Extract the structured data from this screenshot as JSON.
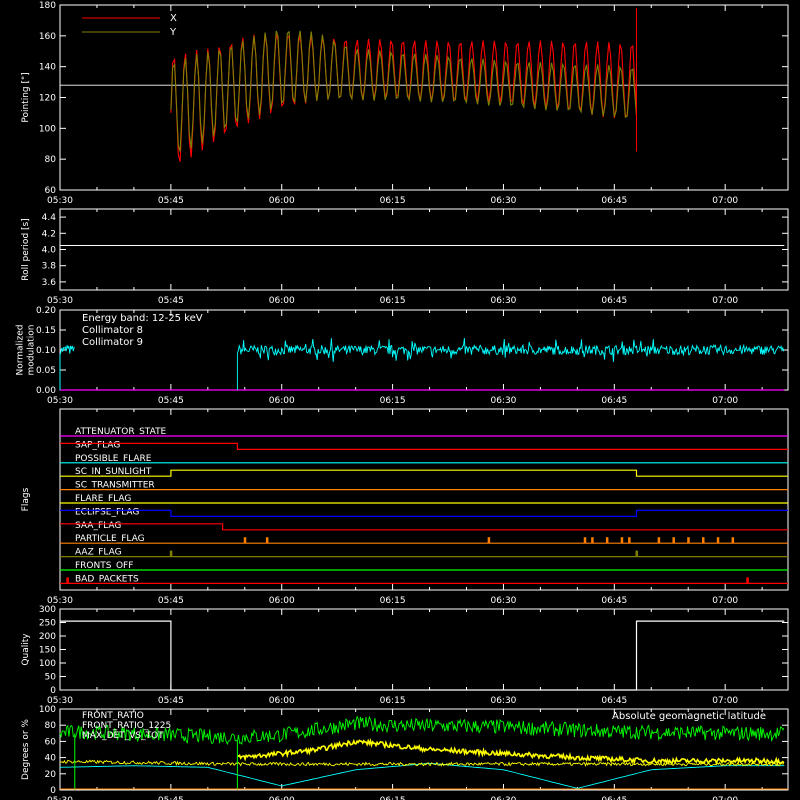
{
  "time_ticks": [
    "05:30",
    "05:45",
    "06:00",
    "06:15",
    "06:30",
    "06:45",
    "07:00"
  ],
  "colors": {
    "x": "#ff0000",
    "y": "#808000",
    "white": "#ffffff",
    "cyan": "#00ffff",
    "magenta": "#ff00ff",
    "red": "#ff0000",
    "orange": "#ff8000",
    "yellow": "#ffff00",
    "blue": "#0000ff",
    "olive": "#808000",
    "green": "#00ff00"
  },
  "chart_data": [
    {
      "type": "line",
      "panel": "pointing",
      "ylabel": "Pointing [\"]",
      "ylim": [
        60,
        180
      ],
      "yticks": [
        60,
        80,
        100,
        120,
        140,
        160,
        180
      ],
      "xlim": [
        "05:30",
        "07:08"
      ],
      "legend": [
        {
          "name": "X"
        },
        {
          "name": "Y"
        }
      ],
      "baseline": 128,
      "data_span": [
        "05:45",
        "06:48"
      ],
      "series": [
        {
          "name": "X",
          "x": [
            "05:45",
            "05:50",
            "05:55",
            "06:00",
            "06:05",
            "06:10",
            "06:15",
            "06:20",
            "06:25",
            "06:30",
            "06:35",
            "06:40",
            "06:45",
            "06:48"
          ],
          "upper": [
            148,
            152,
            160,
            163,
            160,
            158,
            158,
            157,
            157,
            157,
            157,
            157,
            156,
            156
          ],
          "lower": [
            72,
            88,
            102,
            112,
            118,
            118,
            119,
            117,
            117,
            116,
            113,
            110,
            106,
            104
          ]
        },
        {
          "name": "Y",
          "x": [
            "05:45",
            "05:50",
            "05:55",
            "06:00",
            "06:05",
            "06:10",
            "06:15",
            "06:20",
            "06:25",
            "06:30",
            "06:35",
            "06:40",
            "06:45",
            "06:48"
          ],
          "upper": [
            144,
            150,
            158,
            166,
            162,
            152,
            150,
            148,
            146,
            144,
            143,
            142,
            141,
            140
          ],
          "lower": [
            80,
            92,
            105,
            114,
            118,
            118,
            118,
            117,
            116,
            114,
            112,
            110,
            107,
            104
          ]
        }
      ]
    },
    {
      "type": "line",
      "panel": "roll",
      "ylabel": "Roll period [s]",
      "ylim": [
        3.5,
        4.5
      ],
      "yticks": [
        3.6,
        3.8,
        4.0,
        4.2,
        4.4
      ],
      "series": [
        {
          "x": [
            "05:30",
            "07:08"
          ],
          "y": [
            4.05,
            4.05
          ]
        }
      ]
    },
    {
      "type": "line",
      "panel": "modulation",
      "ylabel": [
        "Normalized",
        "modulation"
      ],
      "ylim": [
        0.0,
        0.2
      ],
      "yticks": [
        0.0,
        0.05,
        0.1,
        0.15,
        0.2
      ],
      "annotation": "Energy band: 12-25 keV",
      "series": [
        {
          "name": "Collimator 8",
          "segments": [
            [
              "05:30",
              "05:32"
            ],
            [
              "05:54",
              "07:08"
            ]
          ],
          "level": 0.1,
          "noise": 0.012
        },
        {
          "name": "Collimator 9",
          "segments": [
            [
              "05:30",
              "07:08"
            ]
          ],
          "level": 0.0
        }
      ]
    },
    {
      "type": "line",
      "panel": "flags",
      "ylabel": "Flags",
      "flags": [
        {
          "name": "ATTENUATOR_STATE",
          "color": "magenta",
          "steps": [
            [
              "05:30",
              0
            ]
          ]
        },
        {
          "name": "SAP_FLAG",
          "color": "red",
          "steps": [
            [
              "05:30",
              1
            ],
            [
              "05:54",
              0
            ]
          ]
        },
        {
          "name": "POSSIBLE_FLARE",
          "color": "cyan",
          "steps": [
            [
              "05:30",
              0
            ]
          ]
        },
        {
          "name": "SC_IN_SUNLIGHT",
          "color": "yellow",
          "steps": [
            [
              "05:30",
              0
            ],
            [
              "05:45",
              1
            ],
            [
              "06:48",
              0
            ]
          ]
        },
        {
          "name": "SC_TRANSMITTER",
          "color": "orange",
          "steps": [
            [
              "05:30",
              0
            ]
          ]
        },
        {
          "name": "FLARE_FLAG",
          "color": "yellow",
          "steps": [
            [
              "05:30",
              0
            ]
          ]
        },
        {
          "name": "ECLIPSE_FLAG",
          "color": "blue",
          "steps": [
            [
              "05:30",
              1
            ],
            [
              "05:45",
              0
            ],
            [
              "06:48",
              1
            ]
          ]
        },
        {
          "name": "SAA_FLAG",
          "color": "red",
          "steps": [
            [
              "05:30",
              1
            ],
            [
              "05:52",
              0
            ]
          ]
        },
        {
          "name": "PARTICLE_FLAG",
          "color": "orange",
          "spikes": [
            "05:55",
            "05:58",
            "06:28",
            "06:41",
            "06:42",
            "06:44",
            "06:46",
            "06:47",
            "06:51",
            "06:53",
            "06:55",
            "06:57",
            "06:59",
            "07:01"
          ]
        },
        {
          "name": "AAZ_FLAG",
          "color": "olive",
          "spikes": [
            "05:45",
            "06:48"
          ]
        },
        {
          "name": "FRONTS_OFF",
          "color": "green",
          "steps": [
            [
              "05:30",
              0
            ]
          ]
        },
        {
          "name": "BAD_PACKETS",
          "color": "red",
          "spikes": [
            "05:31",
            "07:03"
          ]
        }
      ]
    },
    {
      "type": "line",
      "panel": "quality",
      "ylabel": "Quality",
      "ylim": [
        0,
        300
      ],
      "yticks": [
        0,
        50,
        100,
        150,
        200,
        250,
        300
      ],
      "series": [
        {
          "x": [
            "05:30",
            "05:45",
            "05:45",
            "06:48",
            "06:48",
            "07:08"
          ],
          "y": [
            255,
            255,
            0,
            0,
            255,
            255
          ]
        }
      ]
    },
    {
      "type": "line",
      "panel": "ratios",
      "ylabel": "Degrees or %",
      "ylim": [
        0,
        100
      ],
      "yticks": [
        0,
        20,
        40,
        60,
        80,
        100
      ],
      "legend": [
        {
          "name": "FRONT_RATIO"
        },
        {
          "name": "FRONT_RATIO_1225"
        },
        {
          "name": "MAX_DET_VS_TOT"
        }
      ],
      "annotation": "Absolute geomagnetic latitude",
      "series": [
        {
          "name": "FRONT_RATIO",
          "x": [
            "05:54",
            "06:00",
            "06:05",
            "06:10",
            "06:15",
            "06:20",
            "06:30",
            "06:40",
            "06:50",
            "07:00",
            "07:08"
          ],
          "y": [
            40,
            45,
            50,
            60,
            55,
            50,
            45,
            40,
            36,
            36,
            36
          ]
        },
        {
          "name": "FRONT_RATIO_1225",
          "x": [
            "05:30",
            "05:32",
            "05:54",
            "06:00",
            "06:05",
            "06:10",
            "06:15",
            "06:30",
            "06:45",
            "07:00",
            "07:08"
          ],
          "y": [
            70,
            72,
            65,
            68,
            75,
            82,
            80,
            78,
            72,
            70,
            70
          ]
        },
        {
          "name": "MAX_DET_VS_TOT",
          "x": [
            "05:30",
            "05:32",
            "05:54",
            "07:08"
          ],
          "y": [
            35,
            35,
            32,
            32
          ]
        },
        {
          "name": "Absolute geomagnetic latitude",
          "x": [
            "05:30",
            "05:40",
            "05:50",
            "06:00",
            "06:10",
            "06:20",
            "06:30",
            "06:40",
            "06:50",
            "07:00",
            "07:08"
          ],
          "y": [
            28,
            30,
            28,
            5,
            25,
            33,
            25,
            2,
            25,
            30,
            30
          ]
        }
      ]
    }
  ]
}
